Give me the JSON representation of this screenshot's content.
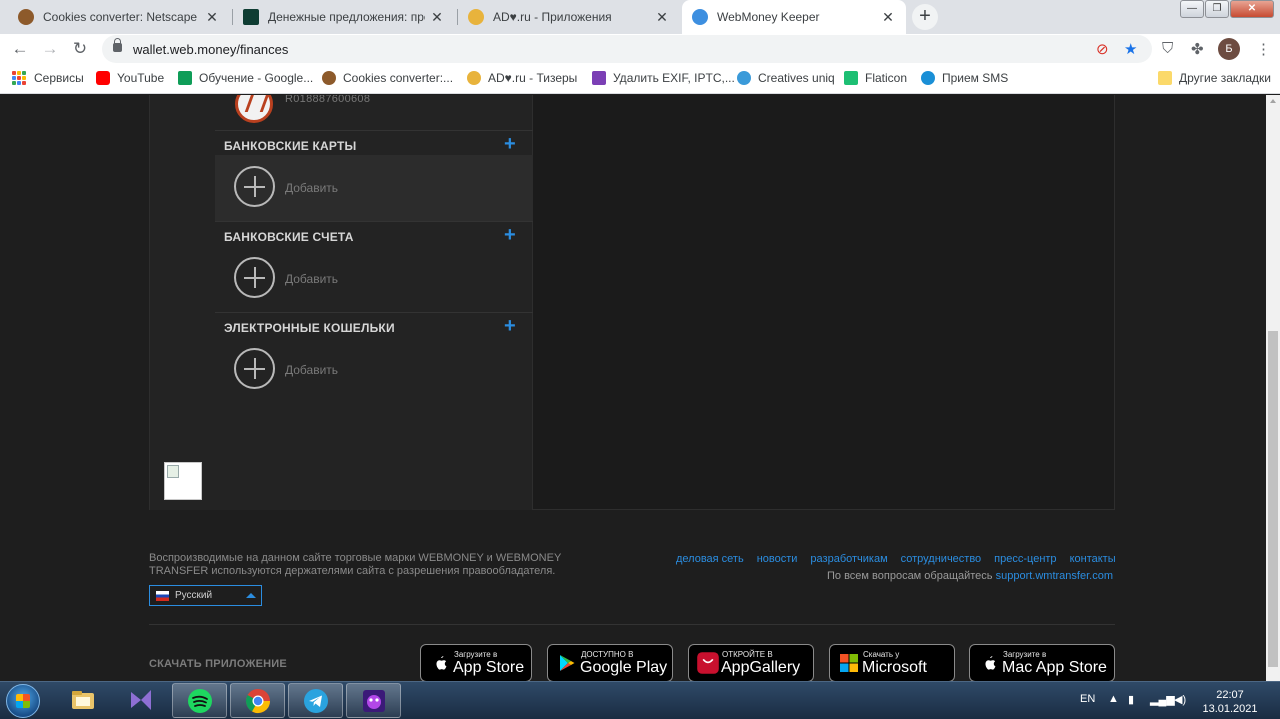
{
  "browser": {
    "tabs": [
      {
        "title": "Cookies converter: Netscape to J",
        "active": false
      },
      {
        "title": "Денежные предложения: предл",
        "active": false
      },
      {
        "title": "AD♥.ru - Приложения",
        "active": false
      },
      {
        "title": "WebMoney Keeper",
        "active": true
      }
    ],
    "address": "wallet.web.money/finances",
    "profile_initial": "Б",
    "bookmarks": [
      {
        "label": "Сервисы"
      },
      {
        "label": "YouTube"
      },
      {
        "label": "Обучение - Google..."
      },
      {
        "label": "Cookies converter:..."
      },
      {
        "label": "AD♥.ru - Тизеры"
      },
      {
        "label": "Удалить EXIF, IPTC,..."
      },
      {
        "label": "Creatives uniq"
      },
      {
        "label": "Flaticon"
      },
      {
        "label": "Прием SMS"
      },
      {
        "label": "Другие закладки"
      }
    ]
  },
  "page": {
    "wallet_id": "R018887600608",
    "sections": [
      {
        "title": "БАНКОВСКИЕ КАРТЫ",
        "add_label": "Добавить"
      },
      {
        "title": "БАНКОВСКИЕ СЧЕТА",
        "add_label": "Добавить"
      },
      {
        "title": "ЭЛЕКТРОННЫЕ КОШЕЛЬКИ",
        "add_label": "Добавить"
      }
    ],
    "footer": {
      "trademark_text": "Воспроизводимые на данном сайте торговые марки WEBMONEY и WEBMONEY TRANSFER используются держателями сайта с разрешения правообладателя.",
      "links": [
        "деловая сеть",
        "новости",
        "разработчикам",
        "сотрудничество",
        "пресс-центр",
        "контакты"
      ],
      "support_prefix": "По всем вопросам обращайтесь",
      "support_link": "support.wmtransfer.com",
      "language": "Русский",
      "download_label": "СКАЧАТЬ ПРИЛОЖЕНИЕ"
    },
    "stores": [
      {
        "small": "Загрузите в",
        "big": "App Store"
      },
      {
        "small": "ДОСТУПНО В",
        "big": "Google Play"
      },
      {
        "small": "ОТКРОЙТЕ В",
        "big": "AppGallery"
      },
      {
        "small": "Скачать у",
        "big": "Microsoft"
      },
      {
        "small": "Загрузите в",
        "big": "Mac App Store"
      }
    ]
  },
  "taskbar": {
    "language": "EN",
    "time": "22:07",
    "date": "13.01.2021"
  },
  "colors": {
    "accent": "#2b8de0",
    "page_bg": "#1e1e1e",
    "panel_bg": "#232323"
  }
}
